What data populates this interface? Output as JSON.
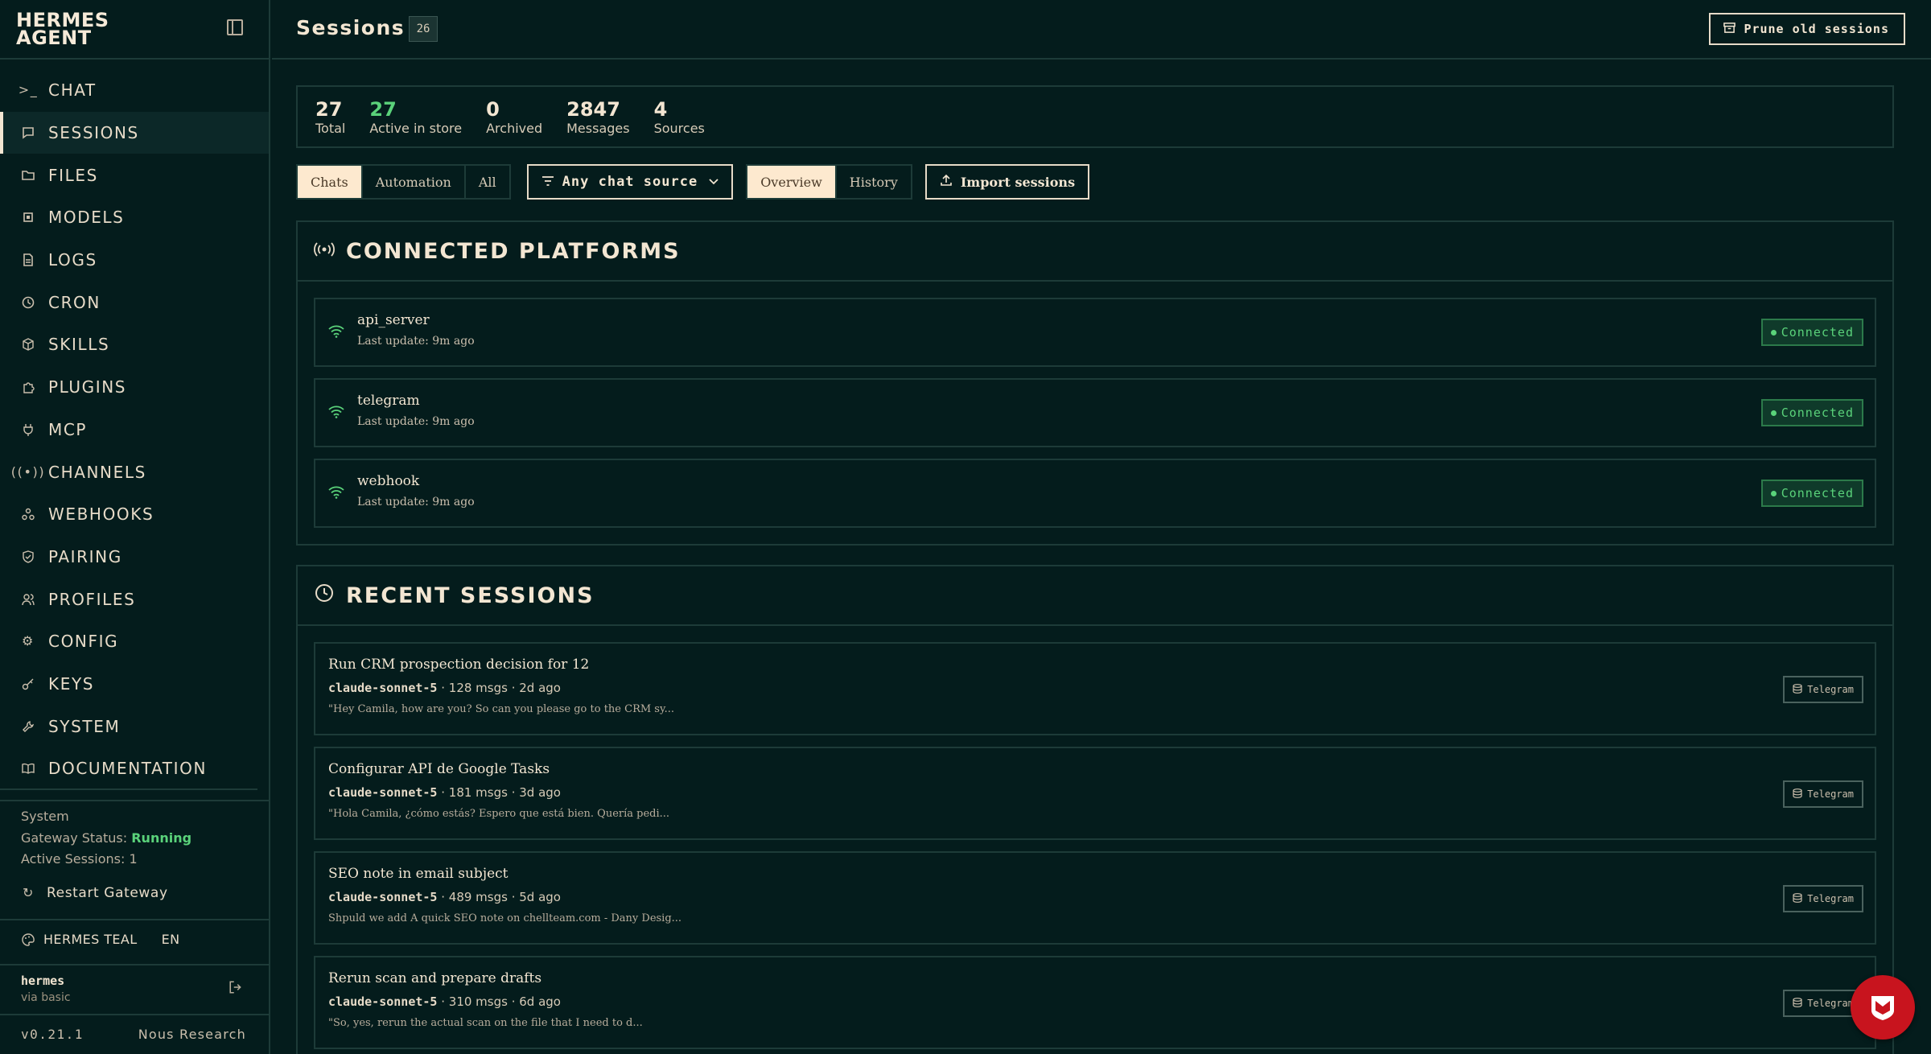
{
  "sidebar": {
    "brand": "HERMES AGENT",
    "nav": [
      {
        "label": "CHAT",
        "icon": "terminal-icon"
      },
      {
        "label": "SESSIONS",
        "icon": "message-square-icon"
      },
      {
        "label": "FILES",
        "icon": "folder-icon"
      },
      {
        "label": "MODELS",
        "icon": "cpu-icon"
      },
      {
        "label": "LOGS",
        "icon": "file-text-icon"
      },
      {
        "label": "CRON",
        "icon": "clock-icon"
      },
      {
        "label": "SKILLS",
        "icon": "package-icon"
      },
      {
        "label": "PLUGINS",
        "icon": "puzzle-icon"
      },
      {
        "label": "MCP",
        "icon": "plug-icon"
      },
      {
        "label": "CHANNELS",
        "icon": "radio-icon"
      },
      {
        "label": "WEBHOOKS",
        "icon": "webhook-icon"
      },
      {
        "label": "PAIRING",
        "icon": "shield-check-icon"
      },
      {
        "label": "PROFILES",
        "icon": "users-icon"
      },
      {
        "label": "CONFIG",
        "icon": "settings-icon"
      },
      {
        "label": "KEYS",
        "icon": "key-icon"
      },
      {
        "label": "SYSTEM",
        "icon": "wrench-icon"
      },
      {
        "label": "DOCUMENTATION",
        "icon": "book-icon"
      }
    ],
    "active_index": 1,
    "system": {
      "heading": "System",
      "gateway_label": "Gateway Status:",
      "gateway_value": "Running",
      "active_sessions": "Active Sessions: 1"
    },
    "restart_label": "Restart Gateway",
    "theme_label": "HERMES TEAL",
    "language": "EN",
    "user": {
      "name": "hermes",
      "auth": "via basic"
    },
    "version": "v0.21.1",
    "org": "Nous Research"
  },
  "header": {
    "title": "Sessions",
    "count": "26",
    "prune_label": "Prune old sessions"
  },
  "stats": [
    {
      "value": "27",
      "label": "Total",
      "highlight": false
    },
    {
      "value": "27",
      "label": "Active in store",
      "highlight": true
    },
    {
      "value": "0",
      "label": "Archived",
      "highlight": false
    },
    {
      "value": "2847",
      "label": "Messages",
      "highlight": false
    },
    {
      "value": "4",
      "label": "Sources",
      "highlight": false
    }
  ],
  "toolbar": {
    "kind_tabs": [
      "Chats",
      "Automation",
      "All"
    ],
    "kind_active": "Chats",
    "source_filter": "Any chat source",
    "view_tabs": [
      "Overview",
      "History"
    ],
    "view_active": "Overview",
    "import_label": "Import sessions"
  },
  "connected_platforms": {
    "title": "CONNECTED PLATFORMS",
    "items": [
      {
        "name": "api_server",
        "updated": "Last update: 9m ago",
        "status": "Connected"
      },
      {
        "name": "telegram",
        "updated": "Last update: 9m ago",
        "status": "Connected"
      },
      {
        "name": "webhook",
        "updated": "Last update: 9m ago",
        "status": "Connected"
      }
    ]
  },
  "recent_sessions": {
    "title": "RECENT SESSIONS",
    "items": [
      {
        "title": "Run CRM prospection decision for 12",
        "model": "claude-sonnet-5",
        "meta": " · 128 msgs · 2d ago",
        "preview": "\"Hey Camila, how are you? So can you please go to the CRM sy...",
        "source": "Telegram"
      },
      {
        "title": "Configurar API de Google Tasks",
        "model": "claude-sonnet-5",
        "meta": " · 181 msgs · 3d ago",
        "preview": "\"Hola Camila, ¿cómo estás? Espero que está bien. Quería pedi...",
        "source": "Telegram"
      },
      {
        "title": "SEO note in email subject",
        "model": "claude-sonnet-5",
        "meta": " · 489 msgs · 5d ago",
        "preview": "Shpuld we add A quick SEO note on chellteam.com - Dany Desig...",
        "source": "Telegram"
      },
      {
        "title": "Rerun scan and prepare drafts",
        "model": "claude-sonnet-5",
        "meta": " · 310 msgs · 6d ago",
        "preview": "\"So, yes, rerun the actual scan on the file that I need to d...",
        "source": "Telegram"
      }
    ]
  },
  "colors": {
    "background": "#041c1c",
    "text": "#f3e6d2",
    "accent_green": "#5ad27a",
    "active_tab": "#fde9cf",
    "fab_red": "#c8141e"
  }
}
